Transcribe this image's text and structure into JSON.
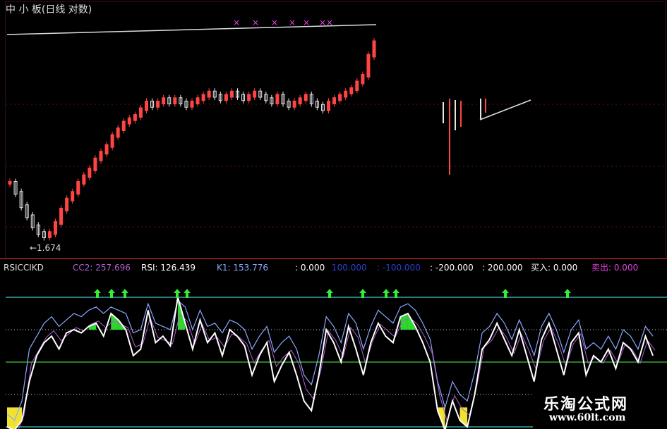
{
  "header": {
    "title": "中 小 板(日线 对数)",
    "x_markers": [
      "×",
      "×",
      "×",
      "×",
      "×",
      "××"
    ],
    "low_label": "←1.674"
  },
  "indicator": {
    "name": "RSICCIKD",
    "items": [
      {
        "label": "CC2: 257.696",
        "color": "#b060d0"
      },
      {
        "label": "RSI: 126.439",
        "color": "#ffffff"
      },
      {
        "label": "K1: 153.776",
        "color": "#8aa8ff"
      },
      {
        "label": ": 0.000",
        "color": "#ffffff"
      },
      {
        "label": "100.000",
        "color": "#2d3fcf"
      },
      {
        "label": ": -100.000",
        "color": "#2d3fcf"
      },
      {
        "label": ": -200.000",
        "color": "#ffffff"
      },
      {
        "label": ": 200.000",
        "color": "#ffffff"
      },
      {
        "label": "买入: 0.000",
        "color": "#ffffff"
      },
      {
        "label": "卖出: 0.000",
        "color": "#e040e0"
      }
    ]
  },
  "watermark": {
    "line1": "乐淘公式网",
    "line2": "www.60lt.com"
  },
  "colors": {
    "up_candle": "#ff4444",
    "down_candle": "#e6e6e6",
    "reference_lines": "#40c8c8",
    "fill": "#33ee33",
    "sell_fill": "#ffee33"
  },
  "chart_data": [
    {
      "type": "line",
      "description_key": "upper price candles",
      "series": [
        {
          "values": [
            58,
            55,
            51,
            48,
            45,
            43,
            42,
            43,
            46,
            50,
            53,
            55,
            58,
            60,
            62,
            65,
            67,
            69,
            72,
            74,
            76,
            77,
            78,
            80,
            82,
            81,
            82,
            83,
            82,
            83,
            82,
            81,
            82,
            83,
            84,
            85,
            84,
            83,
            84,
            85,
            84,
            83,
            84,
            85,
            84,
            83,
            82,
            84,
            82,
            81,
            82,
            83,
            84,
            82,
            81,
            80,
            82,
            83,
            84,
            85,
            86,
            88,
            90,
            96,
            100
          ]
        }
      ]
    },
    {
      "type": "line",
      "description_key": "lower oscillator",
      "series": [
        {
          "values": [
            -200,
            -210,
            -180,
            -60,
            20,
            60,
            80,
            40,
            90,
            100,
            90,
            110,
            120,
            80,
            150,
            130,
            100,
            20,
            40,
            160,
            60,
            80,
            50,
            200,
            120,
            40,
            130,
            60,
            90,
            20,
            100,
            80,
            50,
            -40,
            20,
            60,
            -60,
            -10,
            30,
            -40,
            -120,
            -150,
            -40,
            100,
            60,
            0,
            110,
            40,
            -40,
            60,
            120,
            80,
            60,
            140,
            150,
            110,
            60,
            0,
            -150,
            -210,
            -120,
            -180,
            -200,
            -100,
            40,
            70,
            120,
            70,
            20,
            100,
            20,
            -60,
            70,
            120,
            40,
            -40,
            60,
            90,
            -40,
            20,
            0,
            40,
            -20,
            60,
            40,
            0,
            80,
            20
          ]
        },
        {
          "values": [
            -160,
            -180,
            -120,
            40,
            80,
            120,
            140,
            110,
            130,
            150,
            140,
            160,
            170,
            150,
            170,
            160,
            150,
            90,
            100,
            180,
            120,
            110,
            100,
            190,
            170,
            100,
            160,
            110,
            120,
            90,
            130,
            120,
            100,
            40,
            80,
            110,
            30,
            60,
            80,
            40,
            -40,
            -70,
            20,
            140,
            110,
            60,
            150,
            120,
            40,
            110,
            160,
            140,
            120,
            170,
            180,
            160,
            120,
            70,
            -60,
            -140,
            -60,
            -100,
            -120,
            -30,
            90,
            110,
            150,
            120,
            70,
            130,
            80,
            20,
            110,
            150,
            100,
            30,
            100,
            130,
            40,
            60,
            40,
            80,
            40,
            100,
            80,
            40,
            110,
            80
          ]
        }
      ]
    }
  ]
}
